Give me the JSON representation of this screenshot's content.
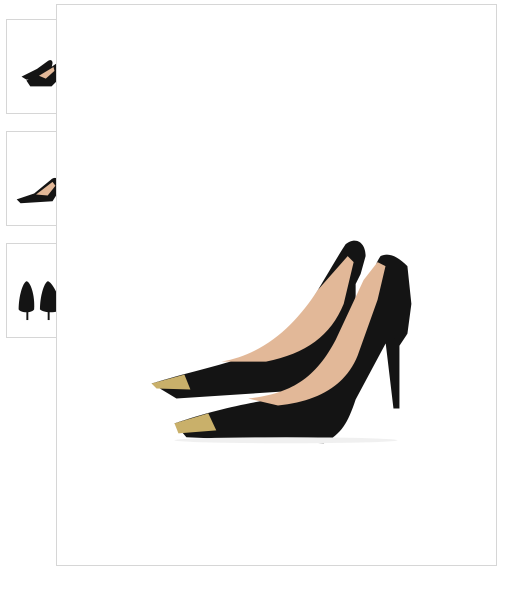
{
  "gallery": {
    "thumbnails": [
      {
        "icon": "pair-angled-icon"
      },
      {
        "icon": "single-side-icon"
      },
      {
        "icon": "pair-back-icon"
      }
    ],
    "main_image": {
      "icon": "black-pointed-pump-pair"
    },
    "colors": {
      "shoe": "#141414",
      "lining": "#e2b898",
      "toe_cap": "#c9b06a",
      "border": "#d6d6d6"
    }
  }
}
